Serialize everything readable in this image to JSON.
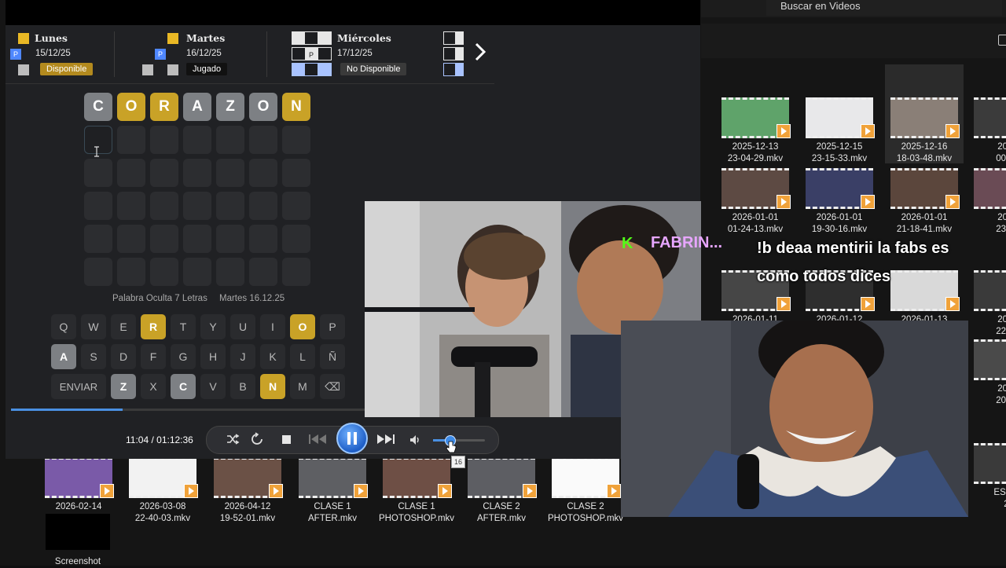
{
  "explorer": {
    "search_label": "Buscar en Videos",
    "files_row1": [
      {
        "name": "2025-12-13\n23-04-29.mkv",
        "thumb": "#5fa36a"
      },
      {
        "name": "2025-12-15\n23-15-33.mkv",
        "thumb": "#e8e8ea"
      },
      {
        "name": "2025-12-16\n18-03-48.mkv",
        "thumb": "#8a7f77"
      },
      {
        "name": "2025\n00-25",
        "thumb": "#3b3b3b"
      }
    ],
    "files_row2": [
      {
        "name": "2026-01-01\n01-24-13.mkv",
        "thumb": "#5d4a43"
      },
      {
        "name": "2026-01-01\n19-30-16.mkv",
        "thumb": "#3a3f66"
      },
      {
        "name": "2026-01-01\n21-18-41.mkv",
        "thumb": "#5b463c"
      },
      {
        "name": "2026\n23-39",
        "thumb": "#6a4b55"
      }
    ],
    "files_row3": [
      {
        "name": "2026-01-11",
        "thumb": "#464646"
      },
      {
        "name": "2026-01-12",
        "thumb": "#2e2e2e"
      },
      {
        "name": "2026-01-13",
        "thumb": "#d9d9d9"
      },
      {
        "name": "2026\n22-13",
        "thumb": "#3a3a3a"
      }
    ],
    "right_col": [
      {
        "name": "2026\n20-37",
        "thumb": "#4a4a4a"
      },
      {
        "name": "ESDIC\n2.",
        "thumb": "#3a3a3a"
      }
    ],
    "files_bottom": [
      {
        "name": "2026-02-14\n22-52-54.mkv",
        "thumb": "#7a5aa8"
      },
      {
        "name": "2026-03-08\n22-40-03.mkv",
        "thumb": "#f2f2f2"
      },
      {
        "name": "2026-04-12\n19-52-01.mkv",
        "thumb": "#6b5146"
      },
      {
        "name": "CLASE 1\nAFTER.mkv",
        "thumb": "#5e5f63"
      },
      {
        "name": "CLASE 1\nPHOTOSHOP.mkv",
        "thumb": "#6e4f45"
      },
      {
        "name": "CLASE 2\nAFTER.mkv",
        "thumb": "#5d5e63"
      },
      {
        "name": "CLASE 2\nPHOTOSHOP.mkv",
        "thumb": "#fafafa"
      }
    ],
    "screenshot_label": "Screenshot"
  },
  "game": {
    "days": [
      {
        "name": "Lunes",
        "date": "15/12/25",
        "status": "Disponible",
        "status_color": "#b38a1e"
      },
      {
        "name": "Martes",
        "date": "16/12/25",
        "status": "Jugado",
        "status_color": "#111111"
      },
      {
        "name": "Miércoles",
        "date": "17/12/25",
        "status": "No Disponible",
        "status_color": "#3a3a3a"
      }
    ],
    "square_letter": "P",
    "word": [
      "C",
      "O",
      "R",
      "A",
      "Z",
      "O",
      "N"
    ],
    "word_states": [
      "gray",
      "yellow",
      "yellow",
      "gray",
      "gray",
      "gray",
      "yellow"
    ],
    "rows": 6,
    "cols": 7,
    "footer_left": "Palabra Oculta 7 Letras",
    "footer_right": "Martes 16.12.25",
    "keyboard": [
      [
        {
          "k": "Q"
        },
        {
          "k": "W"
        },
        {
          "k": "E"
        },
        {
          "k": "R",
          "s": "y"
        },
        {
          "k": "T"
        },
        {
          "k": "Y"
        },
        {
          "k": "U"
        },
        {
          "k": "I"
        },
        {
          "k": "O",
          "s": "y"
        },
        {
          "k": "P"
        }
      ],
      [
        {
          "k": "A",
          "s": "g"
        },
        {
          "k": "S"
        },
        {
          "k": "D"
        },
        {
          "k": "F"
        },
        {
          "k": "G"
        },
        {
          "k": "H"
        },
        {
          "k": "J"
        },
        {
          "k": "K"
        },
        {
          "k": "L"
        },
        {
          "k": "Ñ"
        }
      ],
      [
        {
          "k": "ENVIAR"
        },
        {
          "k": "Z",
          "s": "g"
        },
        {
          "k": "X"
        },
        {
          "k": "C",
          "s": "g"
        },
        {
          "k": "V"
        },
        {
          "k": "B"
        },
        {
          "k": "N",
          "s": "y"
        },
        {
          "k": "M"
        },
        {
          "k": "⌫"
        }
      ]
    ]
  },
  "player": {
    "time": "11:04 / 01:12:36",
    "progress_fraction": 0.02,
    "volume_fraction": 0.16,
    "volume_tooltip": "16"
  },
  "chat": {
    "badge": "K",
    "badge_color": "#53fc18",
    "username": "FABRIN...",
    "username_color": "#e7a6ff",
    "message": "!b deaa mentirii la fabs es como todos dices"
  }
}
